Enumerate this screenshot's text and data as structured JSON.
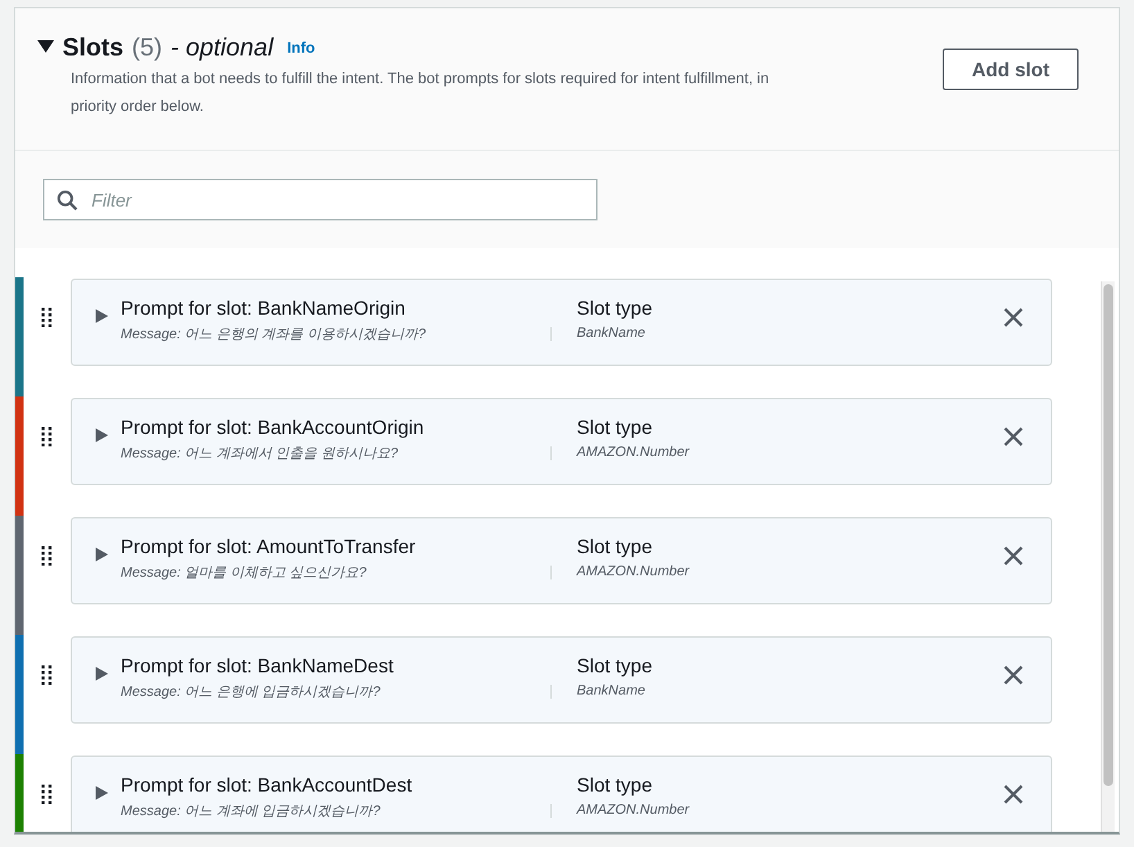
{
  "header": {
    "expanded": true,
    "title": "Slots",
    "count": "(5)",
    "qualifier": "- optional",
    "info_link": "Info",
    "description": "Information that a bot needs to fulfill the intent. The bot prompts for slots required for intent fulfillment, in priority order below.",
    "add_button": "Add slot"
  },
  "filter": {
    "placeholder": "Filter"
  },
  "slots": [
    {
      "color": "#1b7589",
      "expanded": false,
      "title": "Prompt for slot: BankNameOrigin",
      "message": "Message: 어느 은행의 계좌를 이용하시겠습니까?",
      "type_label": "Slot type",
      "type_value": "BankName"
    },
    {
      "color": "#d13212",
      "expanded": false,
      "title": "Prompt for slot: BankAccountOrigin",
      "message": "Message: 어느 계좌에서 인출을 원하시나요?",
      "type_label": "Slot type",
      "type_value": "AMAZON.Number"
    },
    {
      "color": "#5f6670",
      "expanded": false,
      "title": "Prompt for slot: AmountToTransfer",
      "message": "Message: 얼마를 이체하고 싶으신가요?",
      "type_label": "Slot type",
      "type_value": "AMAZON.Number"
    },
    {
      "color": "#0f6fb0",
      "expanded": false,
      "title": "Prompt for slot: BankNameDest",
      "message": "Message: 어느 은행에 입금하시겠습니까?",
      "type_label": "Slot type",
      "type_value": "BankName"
    },
    {
      "color": "#1d8102",
      "expanded": false,
      "title": "Prompt for slot: BankAccountDest",
      "message": "Message: 어느 계좌에 입금하시겠습니까?",
      "type_label": "Slot type",
      "type_value": "AMAZON.Number"
    }
  ]
}
